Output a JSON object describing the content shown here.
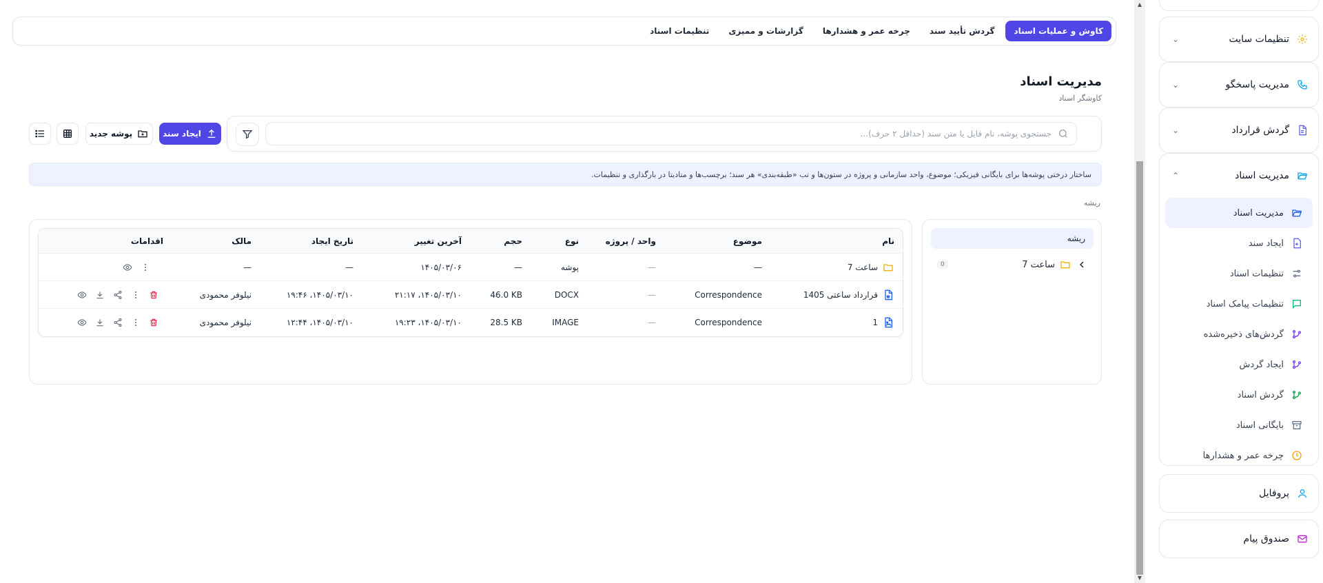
{
  "tabs": [
    {
      "label": "کاوش و عملیات اسناد",
      "active": true
    },
    {
      "label": "گردش تأیید سند",
      "active": false
    },
    {
      "label": "چرخه عمر و هشدارها",
      "active": false
    },
    {
      "label": "گزارشات و ممیزی",
      "active": false
    },
    {
      "label": "تنظیمات اسناد",
      "active": false
    }
  ],
  "page": {
    "title": "مدیریت اسناد",
    "subtitle": "کاوشگر اسناد"
  },
  "search": {
    "placeholder": "جستجوی پوشه، نام فایل یا متن سند (حداقل ۲ حرف)...",
    "value": ""
  },
  "buttons": {
    "create_doc": "ایجاد سند",
    "new_folder": "پوشه جدید"
  },
  "banner": "ساختار درختی پوشه‌ها برای بایگانی فیزیکی؛ موضوع، واحد سازمانی و پروژه در ستون‌ها و تب «طبقه‌بندی» هر سند؛ برچسب‌ها و متادیتا در بارگذاری و تنظیمات.",
  "breadcrumb": "ریشه",
  "tree": {
    "root": "ریشه",
    "items": [
      {
        "label": "ساعت 7",
        "count": "0"
      }
    ]
  },
  "table": {
    "headers": {
      "name": "نام",
      "subject": "موضوع",
      "unit": "واحد / پروژه",
      "type": "نوع",
      "size": "حجم",
      "modified": "آخرین تغییر",
      "created": "تاریخ ایجاد",
      "owner": "مالک",
      "actions": "اقدامات"
    },
    "rows": [
      {
        "name": "ساعت 7",
        "subject": "—",
        "unit": "—",
        "type": "پوشه",
        "size": "—",
        "modified": "۱۴۰۵/۰۳/۰۶",
        "created": "—",
        "owner": "—"
      },
      {
        "name": "قرارداد ساعتی 1405",
        "subject": "Correspondence",
        "unit": "—",
        "type": "DOCX",
        "size": "46.0 KB",
        "modified": "۱۴۰۵/۰۳/۱۰، ۲۱:۱۷",
        "created": "۱۴۰۵/۰۳/۱۰، ۱۹:۴۶",
        "owner": "نیلوفر محمودی"
      },
      {
        "name": "1",
        "subject": "Correspondence",
        "unit": "—",
        "type": "IMAGE",
        "size": "28.5 KB",
        "modified": "۱۴۰۵/۰۳/۱۰، ۱۹:۲۳",
        "created": "۱۴۰۵/۰۳/۱۰، ۱۲:۴۴",
        "owner": "نیلوفر محمودی"
      }
    ]
  },
  "sidebar": {
    "site_settings": "تنظیمات سایت",
    "responder": "مدیریت پاسخگو",
    "contract_flow": "گردش قرارداد",
    "doc_mgmt": "مدیریت اسناد",
    "sub": [
      {
        "label": "مدیریت اسناد",
        "icon": "folder-open-icon",
        "active": true
      },
      {
        "label": "ایجاد سند",
        "icon": "file-plus-icon",
        "active": false
      },
      {
        "label": "تنظیمات اسناد",
        "icon": "sliders-icon",
        "active": false
      },
      {
        "label": "تنظیمات پیامک اسناد",
        "icon": "message-icon",
        "active": false
      },
      {
        "label": "گردش‌های ذخیره‌شده",
        "icon": "workflow-icon",
        "active": false
      },
      {
        "label": "ایجاد گردش",
        "icon": "workflow-icon",
        "active": false
      },
      {
        "label": "گردش اسناد",
        "icon": "workflow-icon",
        "active": false
      },
      {
        "label": "بایگانی اسناد",
        "icon": "archive-icon",
        "active": false
      },
      {
        "label": "چرخه عمر و هشدارها",
        "icon": "clock-icon",
        "active": false
      }
    ],
    "profile": "پروفایل",
    "inbox": "صندوق پیام"
  },
  "colors": {
    "primary": "#4f46e5",
    "banner_bg": "#eef2ff",
    "danger": "#e11d48",
    "folder": "#eab308",
    "doc": "#2563eb"
  }
}
